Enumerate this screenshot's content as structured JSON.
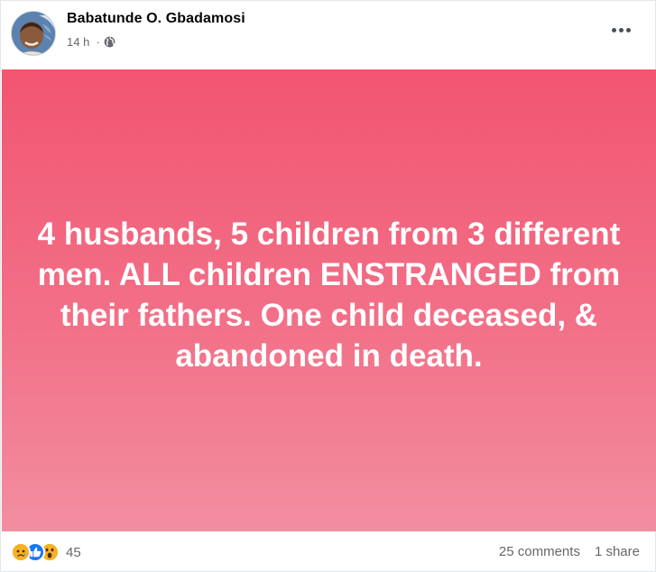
{
  "post": {
    "author": {
      "name": "Babatunde O. Gbadamosi"
    },
    "timestamp": "14 h",
    "audience_icon": "globe-icon",
    "more_icon": "more-options-icon",
    "body_text": "4 husbands, 5 children from 3 different men. ALL children ENSTRANGED from their fathers. One child deceased, & abandoned in death.",
    "background_colors": [
      "#f25570",
      "#f28ea0"
    ],
    "text_color": "#ffffff"
  },
  "footer": {
    "reaction_icons": [
      "sad-icon",
      "like-icon",
      "wow-icon"
    ],
    "reaction_count": "45",
    "comments": "25 comments",
    "shares": "1 share"
  }
}
